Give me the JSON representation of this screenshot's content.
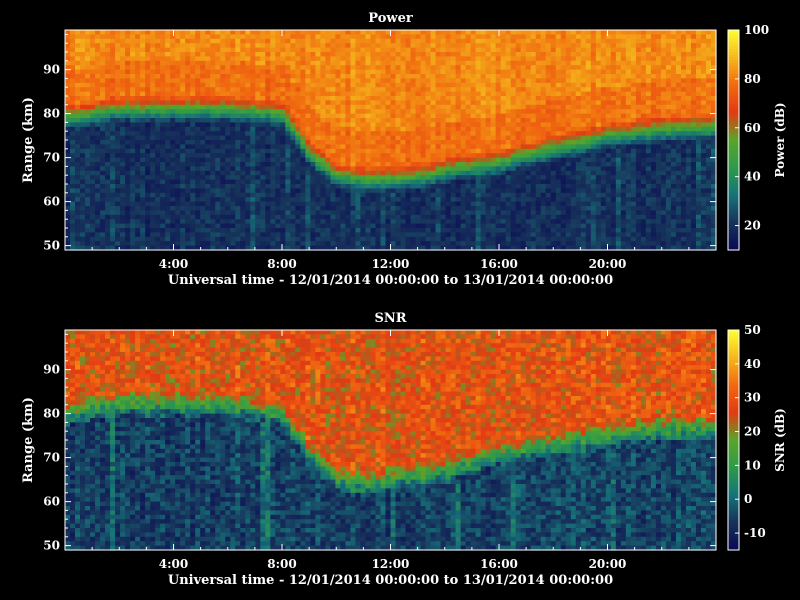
{
  "chart_data": [
    {
      "type": "heatmap",
      "title": "Power",
      "xlabel": "Universal time - 12/01/2014 00:00:00 to 13/01/2014 00:00:00",
      "ylabel": "Range (km)",
      "colorbar_label": "Power (dB)",
      "xlim": [
        0,
        24
      ],
      "ylim": [
        49,
        99
      ],
      "x_ticks": [
        4,
        8,
        12,
        16,
        20
      ],
      "x_tick_labels": [
        "4:00",
        "8:00",
        "12:00",
        "16:00",
        "20:00"
      ],
      "y_ticks": [
        50,
        60,
        70,
        80,
        90
      ],
      "y_tick_labels": [
        "50",
        "60",
        "70",
        "80",
        "90"
      ],
      "clim": [
        10,
        100
      ],
      "colorbar_ticks": [
        20,
        40,
        60,
        80,
        100
      ],
      "colorbar_tick_labels": [
        "20",
        "40",
        "60",
        "80",
        "100"
      ],
      "colormap": [
        "#0a0a55",
        "#17325a",
        "#16737a",
        "#2e9a4a",
        "#5aa52a",
        "#e23a14",
        "#f06a10",
        "#f5b81c",
        "#ffff30"
      ],
      "lower_edge_of_signal_km": {
        "x": [
          0,
          1,
          2,
          4,
          6,
          8,
          9,
          10,
          11,
          12,
          13,
          14,
          16,
          18,
          20,
          22,
          24
        ],
        "y": [
          76,
          77,
          78,
          78,
          78,
          77,
          68,
          63,
          62,
          62,
          62.5,
          64,
          66,
          69,
          72,
          73.5,
          74
        ]
      },
      "noise_floor_db": 20,
      "peak_db": 78
    },
    {
      "type": "heatmap",
      "title": "SNR",
      "xlabel": "Universal time - 12/01/2014 00:00:00 to 13/01/2014 00:00:00",
      "ylabel": "Range (km)",
      "colorbar_label": "SNR (dB)",
      "xlim": [
        0,
        24
      ],
      "ylim": [
        49,
        99
      ],
      "x_ticks": [
        4,
        8,
        12,
        16,
        20
      ],
      "x_tick_labels": [
        "4:00",
        "8:00",
        "12:00",
        "16:00",
        "20:00"
      ],
      "y_ticks": [
        50,
        60,
        70,
        80,
        90
      ],
      "y_tick_labels": [
        "50",
        "60",
        "70",
        "80",
        "90"
      ],
      "clim": [
        -15,
        50
      ],
      "colorbar_ticks": [
        -10,
        0,
        10,
        20,
        30,
        40,
        50
      ],
      "colorbar_tick_labels": [
        "-10",
        "0",
        "10",
        "20",
        "30",
        "40",
        "50"
      ],
      "colormap": [
        "#0a0a55",
        "#17325a",
        "#16737a",
        "#2e9a4a",
        "#5aa52a",
        "#e23a14",
        "#f06a10",
        "#f5b81c",
        "#ffff30"
      ],
      "lower_edge_of_signal_km": {
        "x": [
          0,
          1,
          2,
          4,
          6,
          8,
          9,
          10,
          11,
          12,
          13,
          14,
          16,
          18,
          20,
          22,
          24
        ],
        "y": [
          77,
          78,
          79,
          79,
          79,
          77,
          68,
          62,
          61,
          62,
          63,
          64,
          68,
          70,
          72,
          73.5,
          74
        ]
      },
      "noise_floor_db": -5,
      "peak_db": 28
    }
  ]
}
